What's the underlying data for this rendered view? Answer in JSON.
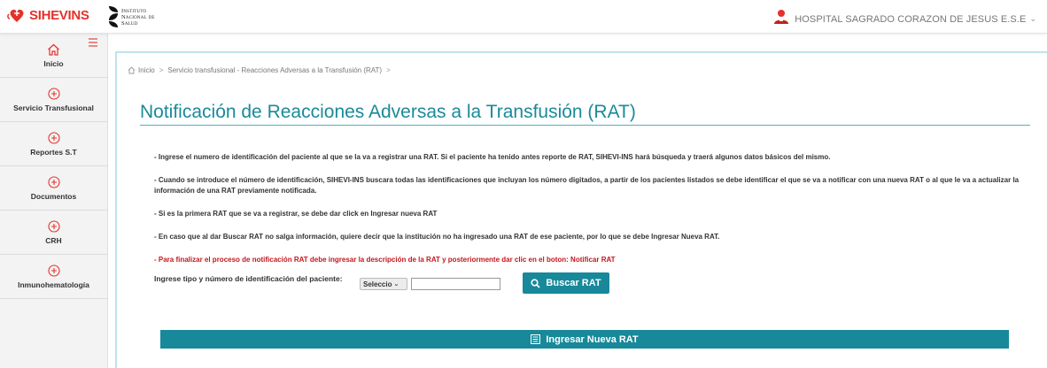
{
  "header": {
    "brand": "SIHEVINS",
    "institute_lines": [
      "Instituto",
      "Nacional de",
      "Salud"
    ],
    "hospital_name": "HOSPITAL SAGRADO CORAZON DE JESUS E.S.E",
    "hospital_caret": "⌄"
  },
  "sidebar": {
    "items": [
      {
        "label": "Inicio",
        "icon": "home-icon"
      },
      {
        "label": "Servicio Transfusional",
        "icon": "plus-circle-icon"
      },
      {
        "label": "Reportes S.T",
        "icon": "plus-circle-icon"
      },
      {
        "label": "Documentos",
        "icon": "plus-circle-icon"
      },
      {
        "label": "CRH",
        "icon": "plus-circle-icon"
      },
      {
        "label": "Inmunohematología",
        "icon": "plus-circle-icon"
      }
    ]
  },
  "breadcrumb": {
    "home": "Inicio",
    "current": "Servicio transfusional - Reacciones Adversas a la Transfusión (RAT)",
    "sep": ">"
  },
  "main": {
    "title": "Notificación de Reacciones Adversas a la Transfusión (RAT)",
    "instructions": [
      "- Ingrese el numero de identificación del paciente al que se la va a registrar una RAT. Si el paciente ha tenido antes reporte de RAT, SIHEVI-INS hará búsqueda y traerá algunos datos básicos del mismo.",
      "- Cuando se introduce el número de identificación, SIHEVI-INS buscara todas las identificaciones que incluyan los número digitados, a partir de los pacientes listados se debe identificar el que se va a notificar con una nueva RAT o al que le va a actualizar la información de una RAT previamente notificada.",
      "- Si es la primera RAT que se va a registrar, se debe dar click en Ingresar nueva RAT",
      "- En caso que al dar Buscar RAT no salga información, quiere decir que la institución no ha ingresado una RAT de ese paciente, por lo que se debe Ingresar Nueva RAT."
    ],
    "warning": "- Para finalizar el proceso de notificación RAT debe ingresar la descripción de la RAT y posteriormente dar clic en el boton: Notificar RAT",
    "search": {
      "label": "Ingrese tipo y número de identificación del paciente:",
      "type_selected": "Seleccio",
      "id_value": "",
      "button_label": "Buscar RAT"
    },
    "new_rat_label": "Ingresar Nueva RAT"
  },
  "colors": {
    "brand_red": "#e4322b",
    "teal": "#17899a",
    "title_teal": "#1a8a99",
    "warning_red": "#c4161c"
  }
}
